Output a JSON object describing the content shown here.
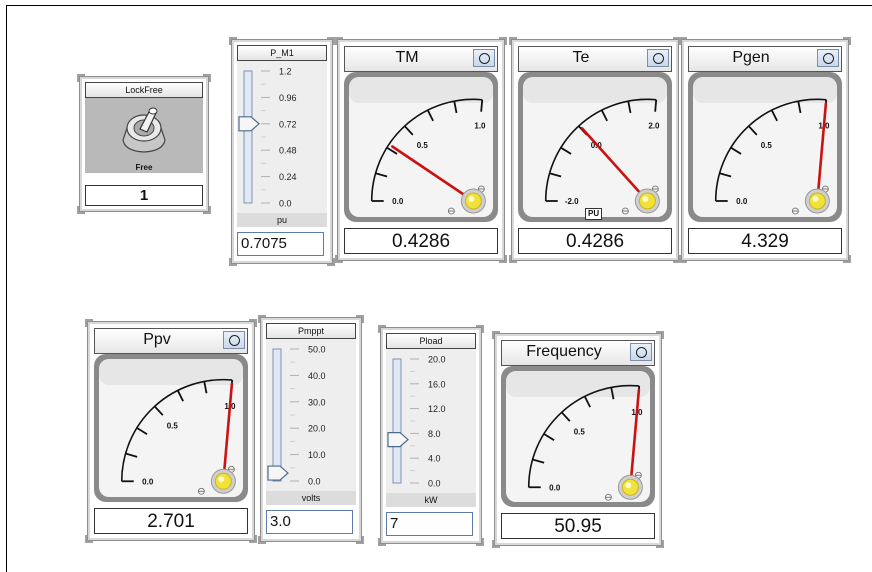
{
  "lockfree": {
    "title": "LockFree",
    "state": "Free",
    "value": "1"
  },
  "sliders": [
    {
      "key": "p_m1",
      "title": "P_M1",
      "unit": "pu",
      "value": "0.7075",
      "position": 0.6,
      "ticks": [
        "1.2",
        "0.96",
        "0.72",
        "0.48",
        "0.24",
        "0.0"
      ]
    },
    {
      "key": "pmppt",
      "title": "Pmppt",
      "unit": "volts",
      "value": "3.0",
      "position": 0.06,
      "ticks": [
        "50.0",
        "40.0",
        "30.0",
        "20.0",
        "10.0",
        "0.0"
      ]
    },
    {
      "key": "pload",
      "title": "Pload",
      "unit": "kW",
      "value": "7",
      "position": 0.35,
      "ticks": [
        "20.0",
        "16.0",
        "12.0",
        "8.0",
        "4.0",
        "0.0"
      ]
    }
  ],
  "gauges": [
    {
      "key": "tm",
      "title": "TM",
      "readout": "0.4286",
      "ticks": [
        "0.0",
        "0.5",
        "1.0"
      ],
      "min": 0,
      "max": 1.2,
      "needle": 0.4286
    },
    {
      "key": "te",
      "title": "Te",
      "readout": "0.4286",
      "ticks": [
        "-2.0",
        "0.0",
        "2.0"
      ],
      "unit": "PU",
      "min": -2,
      "max": 2.8,
      "needle": 0.4286
    },
    {
      "key": "pgen",
      "title": "Pgen",
      "readout": "4.329",
      "ticks": [
        "0.0",
        "0.5",
        "1.0"
      ],
      "min": 0,
      "max": 1.2,
      "needle": 1.25
    },
    {
      "key": "ppv",
      "title": "Ppv",
      "readout": "2.701",
      "ticks": [
        "0.0",
        "0.5",
        "1.0"
      ],
      "min": 0,
      "max": 1.2,
      "needle": 1.25
    },
    {
      "key": "frequency",
      "title": "Frequency",
      "readout": "50.95",
      "ticks": [
        "0.0",
        "0.5",
        "1.0"
      ],
      "min": 0,
      "max": 1.2,
      "needle": 1.25
    }
  ],
  "colors": {
    "needle": "#cc1111",
    "lamp": "#f0e23a",
    "slider_track": "#dfe8f4",
    "dial_bg": "#f4f4f4"
  },
  "icons": {
    "toggle": "toggle-switch-icon",
    "gauge_button": "circle-button-icon",
    "lamp": "indicator-lamp-icon",
    "thumb": "slider-thumb-icon"
  }
}
